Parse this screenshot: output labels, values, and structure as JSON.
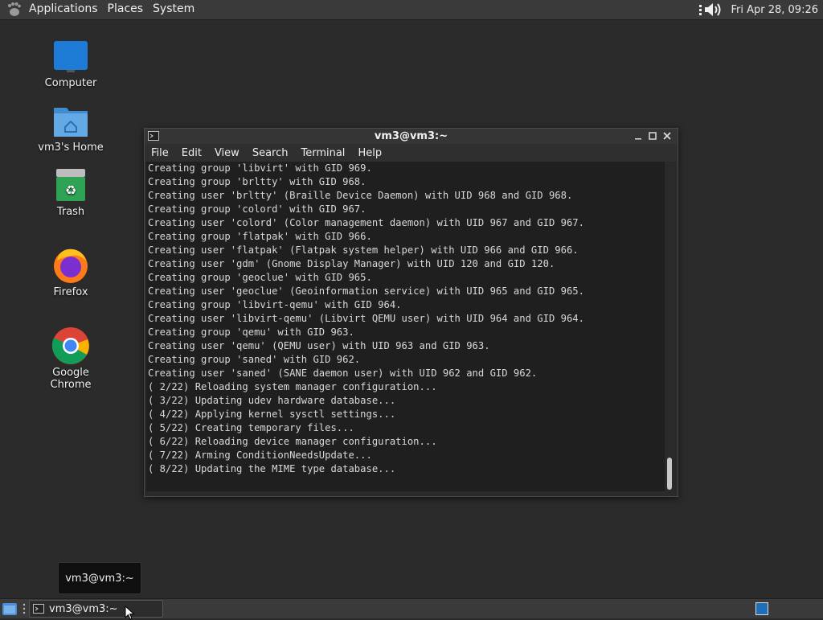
{
  "top_panel": {
    "menus": [
      "Applications",
      "Places",
      "System"
    ],
    "datetime": "Fri Apr 28, 09:26"
  },
  "desktop_icons": [
    {
      "label": "Computer",
      "icon": "computer-icon"
    },
    {
      "label": "vm3's Home",
      "icon": "home-folder-icon"
    },
    {
      "label": "Trash",
      "icon": "trash-icon"
    },
    {
      "label": "Firefox",
      "icon": "firefox-icon"
    },
    {
      "label": "Google Chrome",
      "icon": "chrome-icon"
    }
  ],
  "terminal": {
    "title": "vm3@vm3:~",
    "menu": [
      "File",
      "Edit",
      "View",
      "Search",
      "Terminal",
      "Help"
    ],
    "lines": [
      "Creating group 'libvirt' with GID 969.",
      "Creating group 'brltty' with GID 968.",
      "Creating user 'brltty' (Braille Device Daemon) with UID 968 and GID 968.",
      "Creating group 'colord' with GID 967.",
      "Creating user 'colord' (Color management daemon) with UID 967 and GID 967.",
      "Creating group 'flatpak' with GID 966.",
      "Creating user 'flatpak' (Flatpak system helper) with UID 966 and GID 966.",
      "Creating user 'gdm' (Gnome Display Manager) with UID 120 and GID 120.",
      "Creating group 'geoclue' with GID 965.",
      "Creating user 'geoclue' (Geoinformation service) with UID 965 and GID 965.",
      "Creating group 'libvirt-qemu' with GID 964.",
      "Creating user 'libvirt-qemu' (Libvirt QEMU user) with UID 964 and GID 964.",
      "Creating group 'qemu' with GID 963.",
      "Creating user 'qemu' (QEMU user) with UID 963 and GID 963.",
      "Creating group 'saned' with GID 962.",
      "Creating user 'saned' (SANE daemon user) with UID 962 and GID 962.",
      "( 2/22) Reloading system manager configuration...",
      "( 3/22) Updating udev hardware database...",
      "( 4/22) Applying kernel sysctl settings...",
      "( 5/22) Creating temporary files...",
      "( 6/22) Reloading device manager configuration...",
      "( 7/22) Arming ConditionNeedsUpdate...",
      "( 8/22) Updating the MIME type database..."
    ]
  },
  "tooltip": "vm3@vm3:~",
  "taskbar": {
    "task_label": "vm3@vm3:~"
  }
}
